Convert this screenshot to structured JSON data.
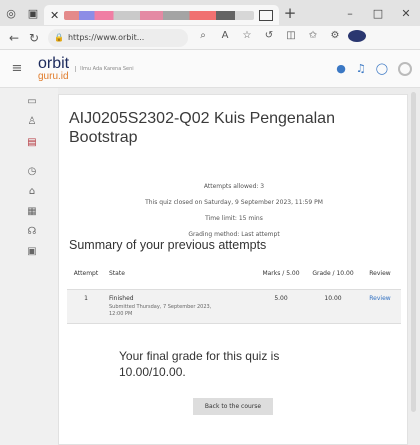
{
  "browser": {
    "url": "https://www.orbit...",
    "new_tab_label": "+",
    "win_min": "–",
    "win_max": "□",
    "win_close": "✕"
  },
  "site": {
    "logo_main": "orbit",
    "logo_sub": "guru.id",
    "logo_tagline": "Ilmu Ada Karena Seni"
  },
  "quiz": {
    "title": "AIJ0205S2302-Q02 Kuis Pengenalan Bootstrap",
    "attempts_allowed": "Attempts allowed: 3",
    "closed_on": "This quiz closed on Saturday, 9 September 2023, 11:59 PM",
    "time_limit": "Time limit: 15 mins",
    "grading_method": "Grading method: Last attempt"
  },
  "summary": {
    "heading": "Summary of your previous attempts",
    "columns": {
      "attempt": "Attempt",
      "state": "State",
      "marks": "Marks / 5.00",
      "grade": "Grade / 10.00",
      "review": "Review"
    },
    "rows": [
      {
        "attempt": "1",
        "state": "Finished",
        "submitted": "Submitted Thursday, 7 September 2023, 12:00 PM",
        "marks": "5.00",
        "grade": "10.00",
        "review": "Review"
      }
    ]
  },
  "final_grade": "Your final grade for this quiz is 10.00/10.00.",
  "back_button": "Back to the course"
}
